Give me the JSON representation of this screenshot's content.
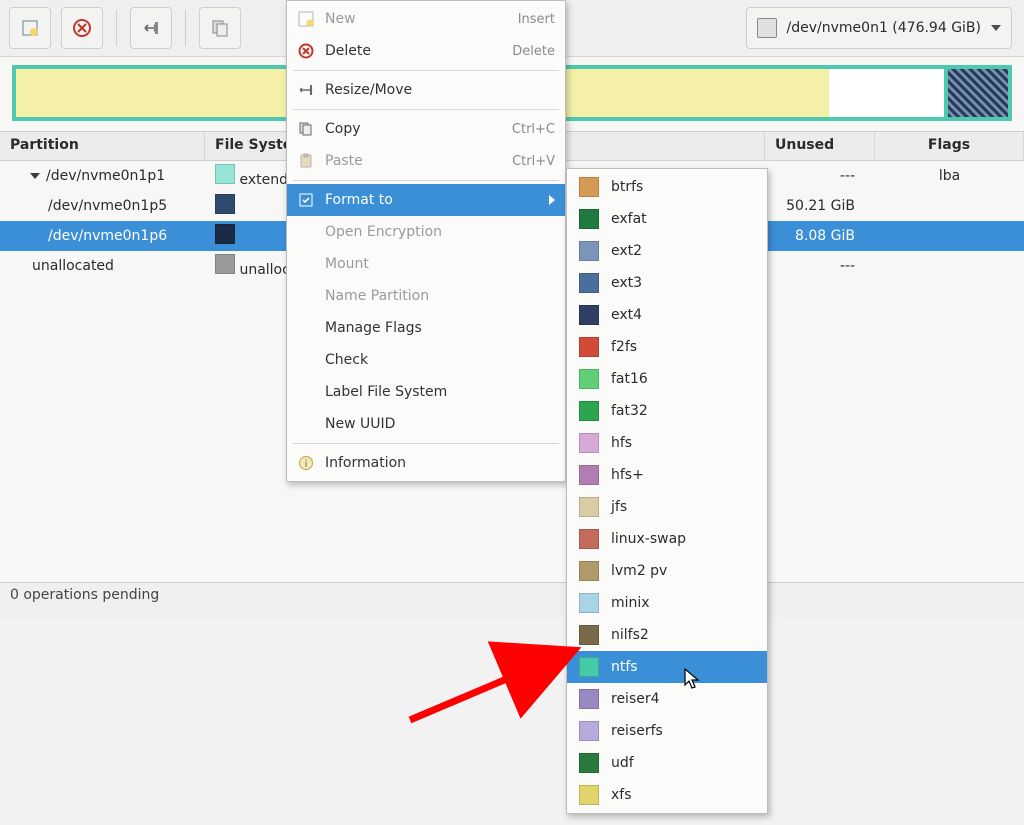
{
  "device": {
    "label": "/dev/nvme0n1 (476.94 GiB)"
  },
  "columns": {
    "partition": "Partition",
    "filesystem": "File System",
    "unused": "Unused",
    "flags": "Flags"
  },
  "usage": {
    "used_pct": 82,
    "tail_pct": 6
  },
  "rows": [
    {
      "name": "/dev/nvme0n1p1",
      "fs": "extended",
      "swatch": "#95e6d6",
      "unused": "---",
      "flags": "lba",
      "indent": 1,
      "expander": true
    },
    {
      "name": "/dev/nvme0n1p5",
      "fs": "",
      "swatch": "#2f4a6b",
      "unused": "50.21 GiB",
      "flags": "",
      "indent": 2
    },
    {
      "name": "/dev/nvme0n1p6",
      "fs": "",
      "swatch": "#1b2a45",
      "unused": "8.08 GiB",
      "flags": "",
      "indent": 2,
      "selected": true
    },
    {
      "name": "unallocated",
      "fs": "unallocated",
      "swatch": "#9a9a9a",
      "unused": "---",
      "flags": "",
      "indent": 1
    }
  ],
  "status": "0 operations pending",
  "menu": [
    {
      "icon": "new",
      "label": "New",
      "accel": "Insert",
      "disabled": true
    },
    {
      "icon": "delete",
      "label": "Delete",
      "accel": "Delete"
    },
    {
      "sep": true
    },
    {
      "icon": "resize",
      "label": "Resize/Move"
    },
    {
      "sep": true
    },
    {
      "icon": "copy",
      "label": "Copy",
      "accel": "Ctrl+C"
    },
    {
      "icon": "paste",
      "label": "Paste",
      "accel": "Ctrl+V",
      "disabled": true
    },
    {
      "sep": true
    },
    {
      "icon": "format",
      "label": "Format to",
      "submenu": true,
      "highlight": true
    },
    {
      "label": "Open Encryption",
      "disabled": true
    },
    {
      "label": "Mount",
      "disabled": true
    },
    {
      "label": "Name Partition",
      "disabled": true
    },
    {
      "label": "Manage Flags"
    },
    {
      "label": "Check"
    },
    {
      "label": "Label File System"
    },
    {
      "label": "New UUID"
    },
    {
      "sep": true
    },
    {
      "icon": "info",
      "label": "Information"
    }
  ],
  "formats": [
    {
      "name": "btrfs",
      "color": "#d59b55"
    },
    {
      "name": "exfat",
      "color": "#1e7a3e"
    },
    {
      "name": "ext2",
      "color": "#7a95b8"
    },
    {
      "name": "ext3",
      "color": "#4a6f9c"
    },
    {
      "name": "ext4",
      "color": "#2f3f63"
    },
    {
      "name": "f2fs",
      "color": "#d24a3a"
    },
    {
      "name": "fat16",
      "color": "#5fcf7a"
    },
    {
      "name": "fat32",
      "color": "#2da44e"
    },
    {
      "name": "hfs",
      "color": "#d7a9d7"
    },
    {
      "name": "hfs+",
      "color": "#b27db2"
    },
    {
      "name": "jfs",
      "color": "#d7cca3"
    },
    {
      "name": "linux-swap",
      "color": "#c46a5a"
    },
    {
      "name": "lvm2 pv",
      "color": "#b09a6a"
    },
    {
      "name": "minix",
      "color": "#a9d3e6"
    },
    {
      "name": "nilfs2",
      "color": "#7a6a4a"
    },
    {
      "name": "ntfs",
      "color": "#46c9a5",
      "highlight": true
    },
    {
      "name": "reiser4",
      "color": "#9a88c2"
    },
    {
      "name": "reiserfs",
      "color": "#b8aadb"
    },
    {
      "name": "udf",
      "color": "#2a7a3e"
    },
    {
      "name": "xfs",
      "color": "#e2d46a"
    }
  ]
}
